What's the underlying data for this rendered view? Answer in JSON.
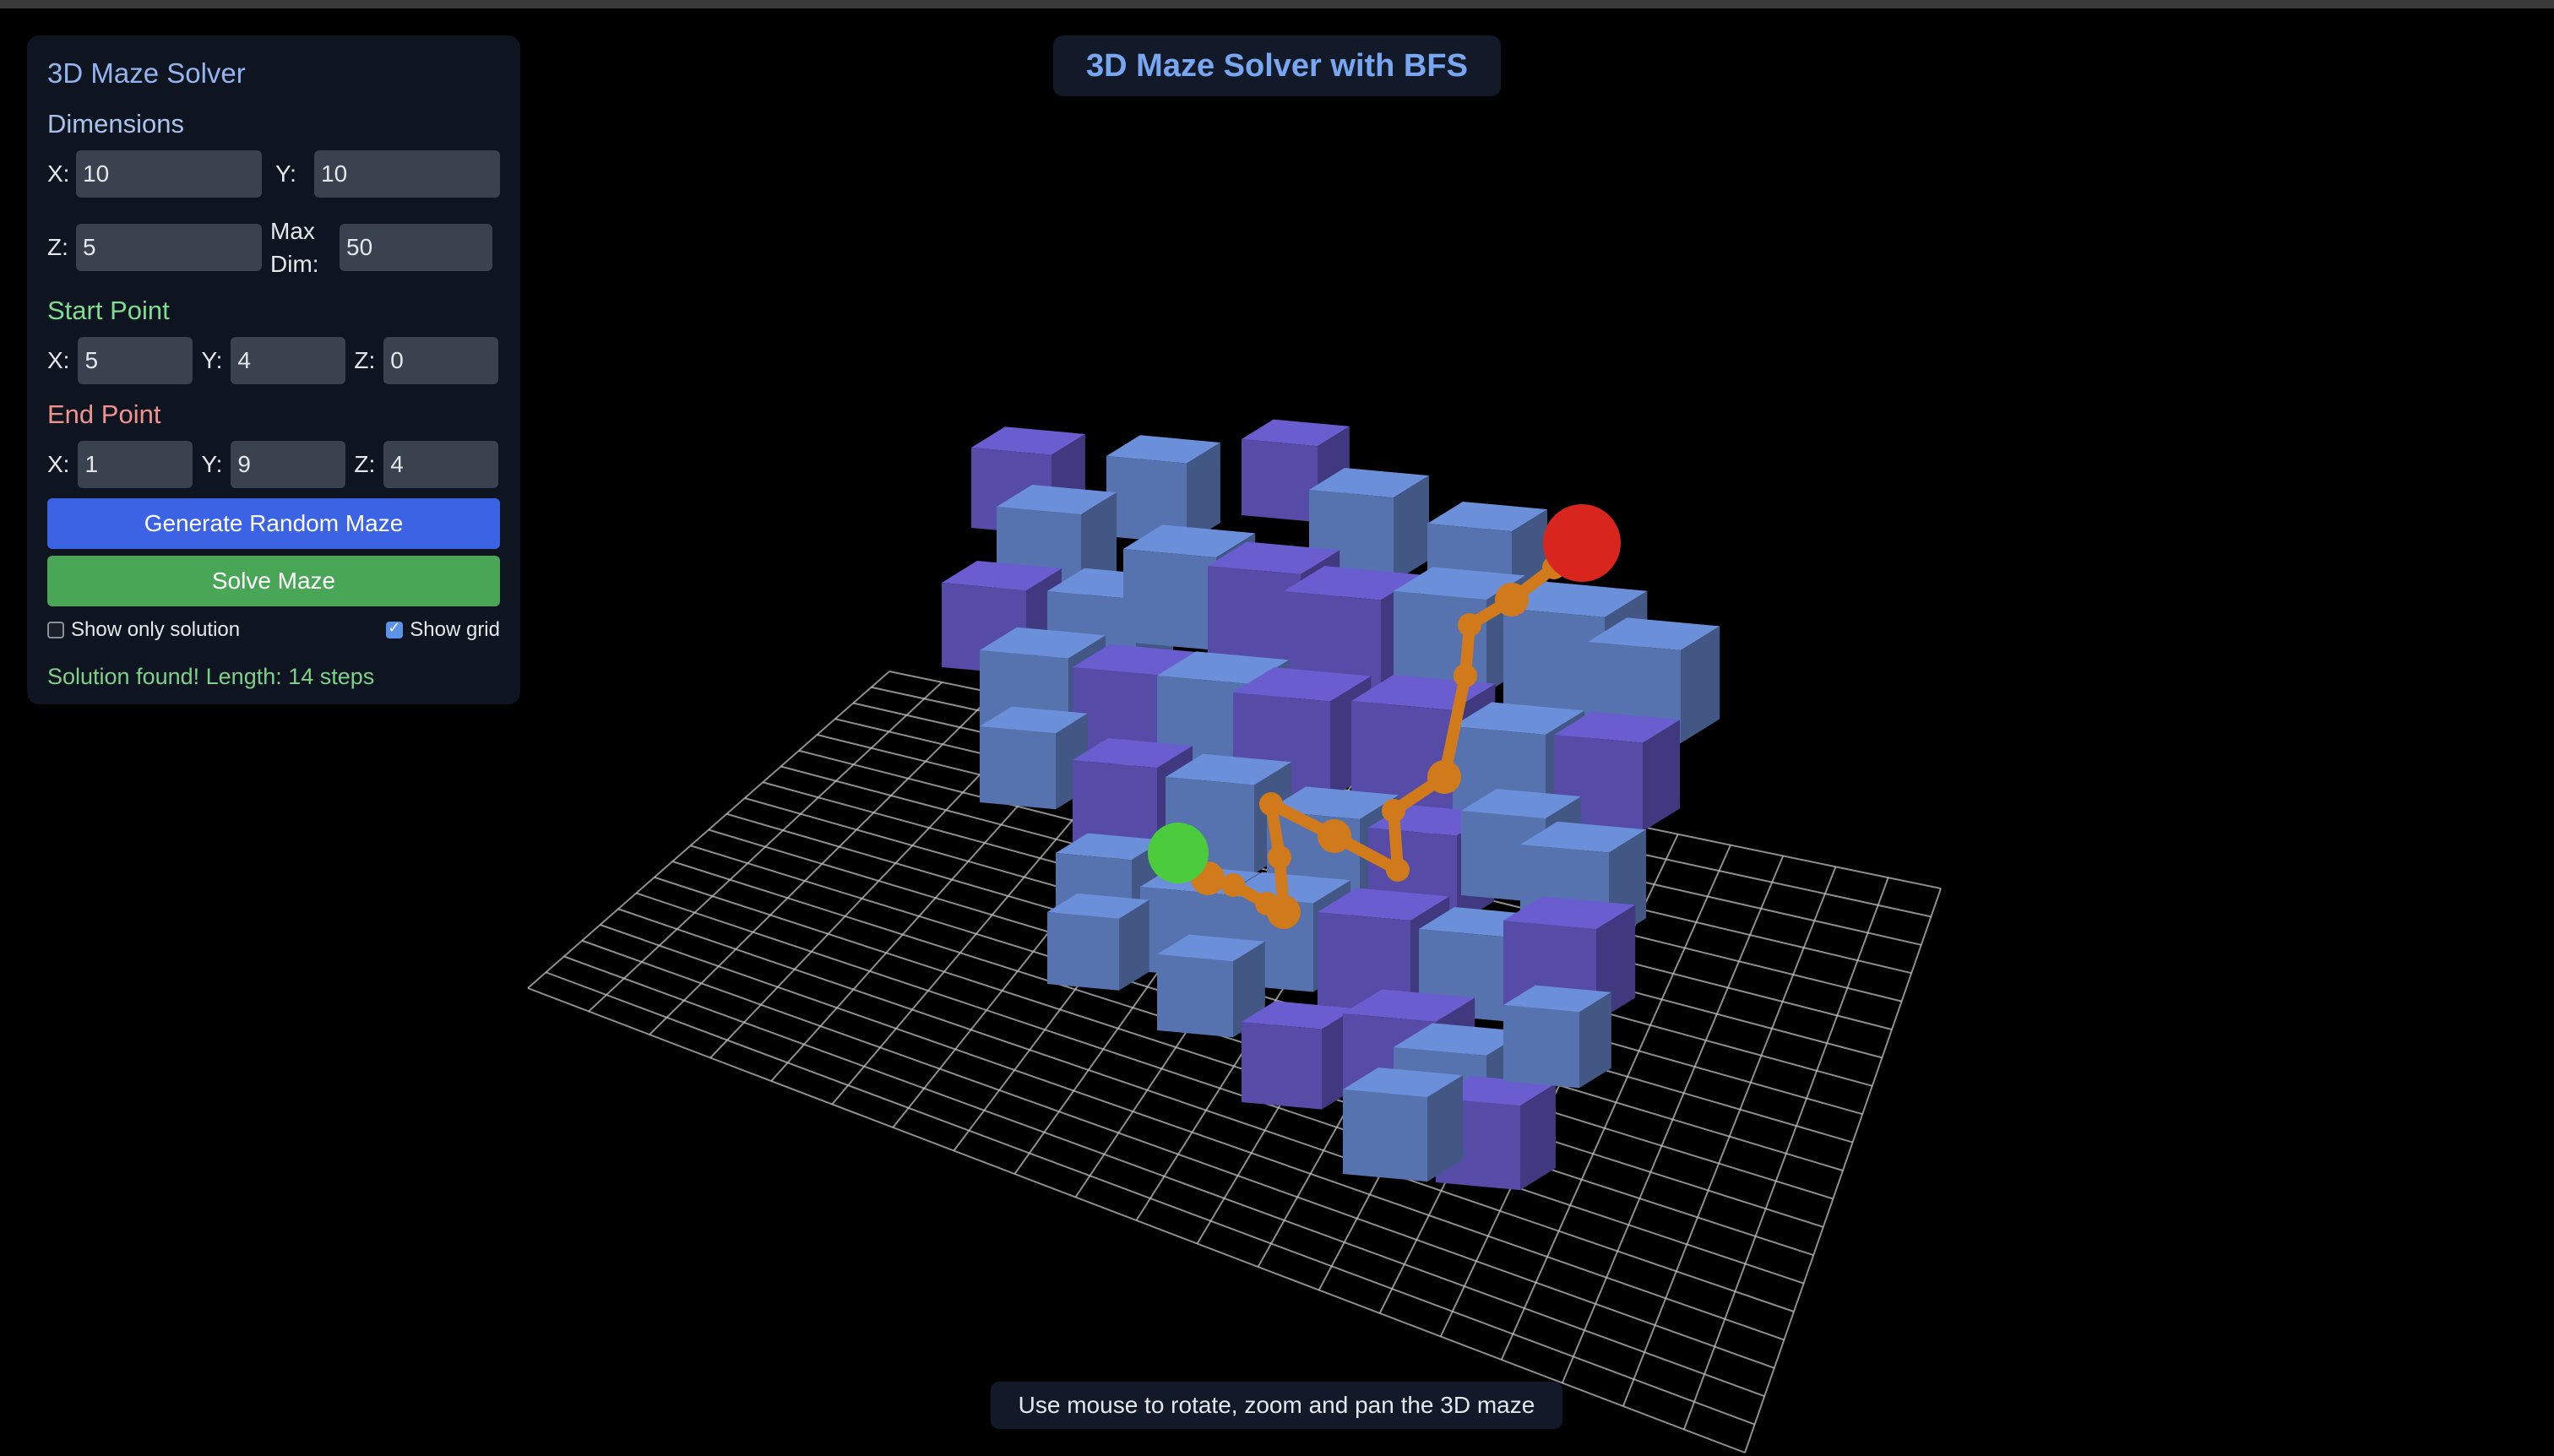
{
  "page_title": "3D Maze Solver with BFS",
  "panel": {
    "title": "3D Maze Solver",
    "dimensions": {
      "heading": "Dimensions",
      "x_label": "X:",
      "x_value": "10",
      "y_label": "Y:",
      "y_value": "10",
      "z_label": "Z:",
      "z_value": "5",
      "max_label": "Max Dim:",
      "max_value": "50"
    },
    "start": {
      "heading": "Start Point",
      "x_label": "X:",
      "x_value": "5",
      "y_label": "Y:",
      "y_value": "4",
      "z_label": "Z:",
      "z_value": "0"
    },
    "end": {
      "heading": "End Point",
      "x_label": "X:",
      "x_value": "1",
      "y_label": "Y:",
      "y_value": "9",
      "z_label": "Z:",
      "z_value": "4"
    },
    "generate_label": "Generate Random Maze",
    "solve_label": "Solve Maze",
    "show_only_solution": {
      "label": "Show only solution",
      "checked": false
    },
    "show_grid": {
      "label": "Show grid",
      "checked": true
    },
    "status": "Solution found! Length: 14 steps"
  },
  "hint": "Use mouse to rotate, zoom and pan the 3D maze",
  "colors": {
    "cube_blue": "#5b79b8",
    "cube_purple": "#5a4fb0",
    "start_marker": "#4ccc3c",
    "end_marker": "#d8261e",
    "path": "#d07a1c",
    "grid": "#bdbdbd"
  }
}
